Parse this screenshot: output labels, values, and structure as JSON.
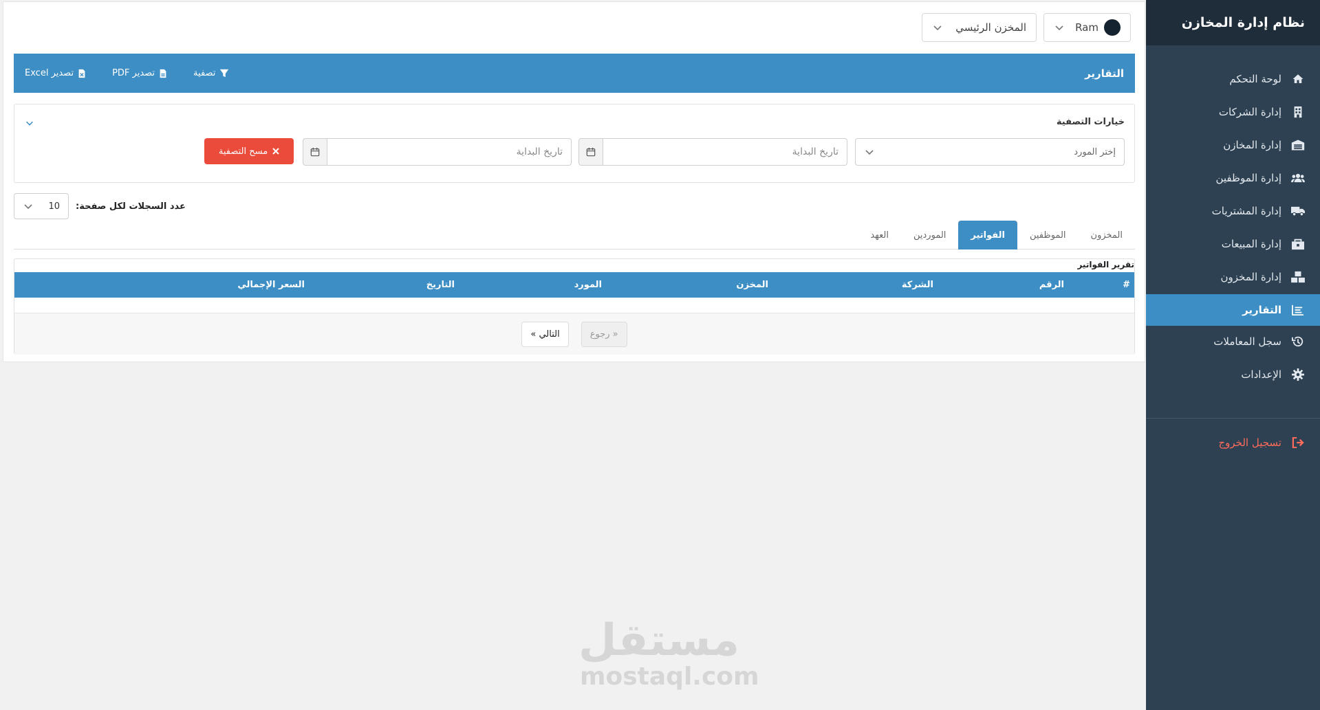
{
  "brand": "نظام إدارة المخازن",
  "nav": [
    {
      "label": "لوحة التحكم",
      "icon": "home-icon"
    },
    {
      "label": "إدارة الشركات",
      "icon": "building-icon"
    },
    {
      "label": "إدارة المخازن",
      "icon": "warehouse-icon"
    },
    {
      "label": "إدارة الموظفين",
      "icon": "users-icon"
    },
    {
      "label": "إدارة المشتريات",
      "icon": "truck-icon"
    },
    {
      "label": "إدارة المبيعات",
      "icon": "cart-box-icon"
    },
    {
      "label": "إدارة المخزون",
      "icon": "boxes-icon"
    },
    {
      "label": "التقارير",
      "icon": "report-icon"
    },
    {
      "label": "سجل المعاملات",
      "icon": "history-icon"
    },
    {
      "label": "الإعدادات",
      "icon": "gear-icon"
    }
  ],
  "logout": "تسجيل الخروج",
  "topbar": {
    "user": "Ram",
    "store": "المخزن الرئيسي"
  },
  "header": {
    "title": "التقارير",
    "filter": "تصفية",
    "pdf": "تصدير PDF",
    "excel": "تصدير Excel"
  },
  "filters": {
    "title": "خيارات التصفية",
    "supplier_placeholder": "إختر المورد",
    "start_date_1": "تاريخ البداية",
    "start_date_2": "تاريخ البداية",
    "clear": "مسح التصفية"
  },
  "perpage": {
    "label": "عدد السجلات لكل صفحة:",
    "value": "10"
  },
  "tabs": [
    "المخزون",
    "الموظفين",
    "الفواتير",
    "الموردين",
    "العهد"
  ],
  "report": {
    "title": "تقرير الفواتير",
    "columns": [
      "#",
      "الرقم",
      "الشركة",
      "المخزن",
      "المورد",
      "التاريخ",
      "السعر الإجمالي"
    ],
    "prev": "« رجوع",
    "next": "التالي »"
  },
  "watermark": {
    "ar": "مستقل",
    "en": "mostaql.com"
  },
  "colors": {
    "primary": "#3d8ec4",
    "sidebar": "#2e4152",
    "danger": "#ea4b3a"
  }
}
